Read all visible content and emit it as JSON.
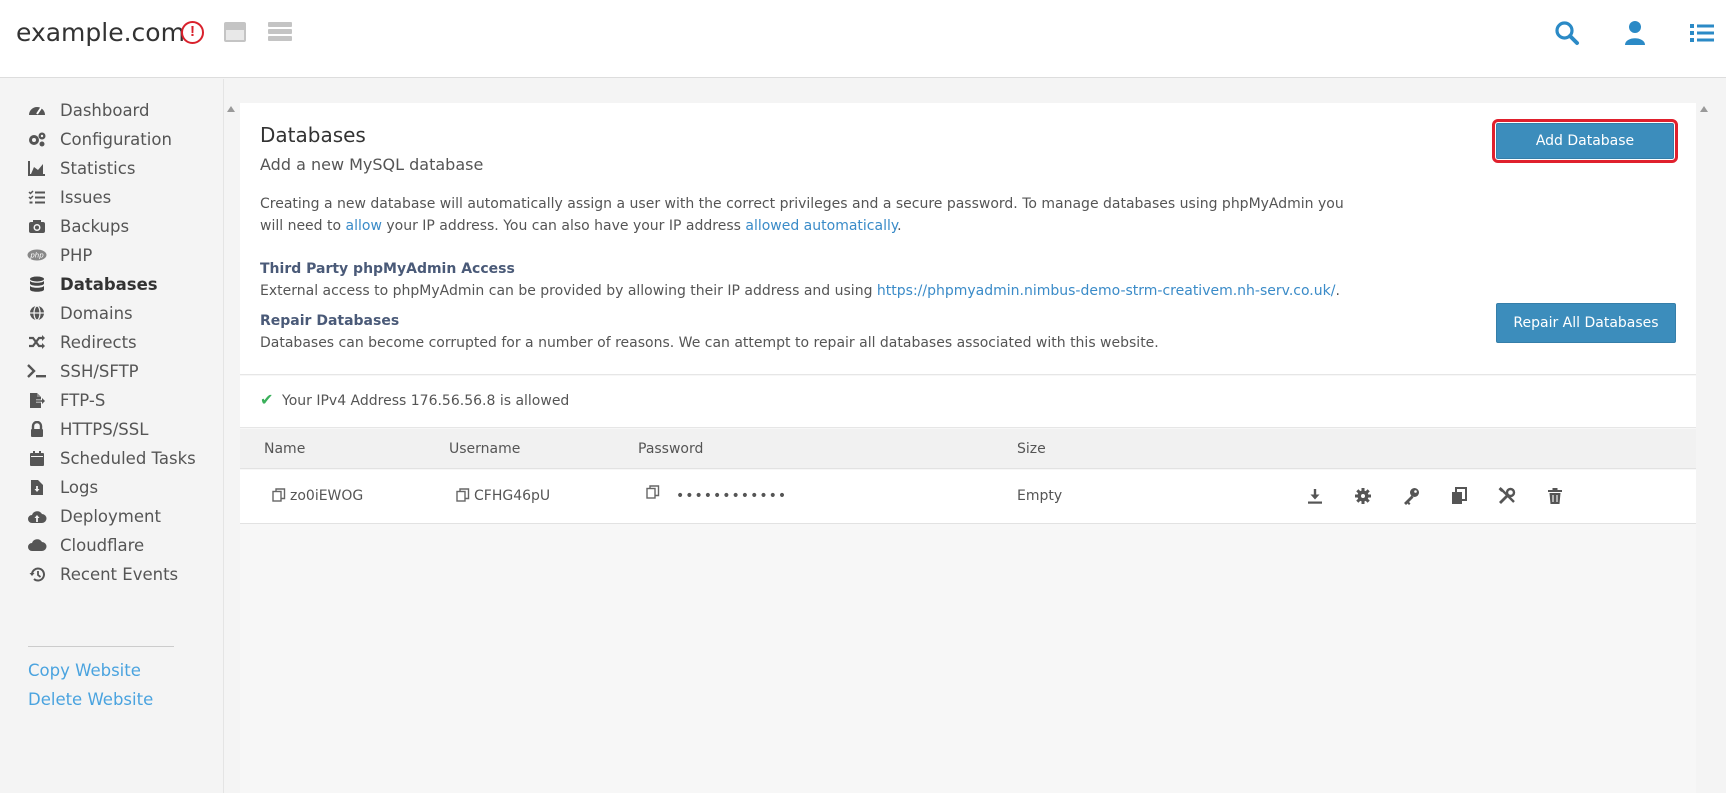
{
  "header": {
    "site_title": "example.com"
  },
  "sidebar": {
    "items": [
      {
        "label": "Dashboard",
        "icon": "gauge-icon"
      },
      {
        "label": "Configuration",
        "icon": "gears-icon"
      },
      {
        "label": "Statistics",
        "icon": "area-chart-icon"
      },
      {
        "label": "Issues",
        "icon": "checklist-icon"
      },
      {
        "label": "Backups",
        "icon": "camera-icon"
      },
      {
        "label": "PHP",
        "icon": "php-icon"
      },
      {
        "label": "Databases",
        "icon": "database-icon"
      },
      {
        "label": "Domains",
        "icon": "globe-icon"
      },
      {
        "label": "Redirects",
        "icon": "shuffle-icon"
      },
      {
        "label": "SSH/SFTP",
        "icon": "terminal-icon"
      },
      {
        "label": "FTP-S",
        "icon": "file-export-icon"
      },
      {
        "label": "HTTPS/SSL",
        "icon": "lock-icon"
      },
      {
        "label": "Scheduled Tasks",
        "icon": "calendar-icon"
      },
      {
        "label": "Logs",
        "icon": "file-download-icon"
      },
      {
        "label": "Deployment",
        "icon": "cloud-upload-icon"
      },
      {
        "label": "Cloudflare",
        "icon": "cloud-icon"
      },
      {
        "label": "Recent Events",
        "icon": "history-icon"
      }
    ],
    "active": "Databases",
    "links": {
      "copy": "Copy Website",
      "delete": "Delete Website"
    }
  },
  "main": {
    "title": "Databases",
    "subtitle": "Add a new MySQL database",
    "desc_part1": "Creating a new database will automatically assign a user with the correct privileges and a secure password. To manage databases using phpMyAdmin you will need to ",
    "desc_link1": "allow",
    "desc_part2": " your IP address. You can also have your IP address ",
    "desc_link2": "allowed automatically",
    "desc_part3": ".",
    "third_party_title": "Third Party phpMyAdmin Access",
    "third_party_text": "External access to phpMyAdmin can be provided by allowing their IP address and using ",
    "third_party_link": "https://phpmyadmin.nimbus-demo-strm-creativem.nh-serv.co.uk/",
    "third_party_end": ".",
    "repair_title": "Repair Databases",
    "repair_text": "Databases can become corrupted for a number of reasons. We can attempt to repair all databases associated with this website.",
    "add_button": "Add Database",
    "repair_button": "Repair All Databases",
    "ip_status": "Your IPv4 Address 176.56.56.8 is allowed",
    "colors": {
      "accent": "#3c8dbc",
      "highlight": "#e0202d",
      "success": "#3ab05b",
      "link": "#4aa3df"
    }
  },
  "table": {
    "columns": [
      "Name",
      "Username",
      "Password",
      "Size"
    ],
    "rows": [
      {
        "name": "zo0iEWOG",
        "username": "CFHG46pU",
        "password": "••••••••••••",
        "size": "Empty"
      }
    ]
  }
}
